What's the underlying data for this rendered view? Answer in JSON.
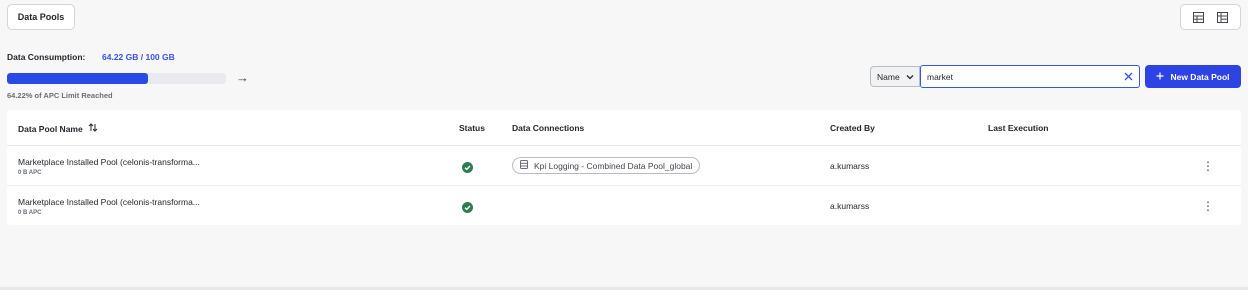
{
  "tabs": {
    "data_pools": "Data Pools"
  },
  "consumption": {
    "label": "Data Consumption:",
    "value": "64.22 GB / 100 GB",
    "percent": 64.22,
    "limit_text": "64.22% of APC Limit Reached"
  },
  "search": {
    "filter_field": "Name",
    "query": "market"
  },
  "toolbar": {
    "new_pool_label": "New Data Pool"
  },
  "table": {
    "headers": {
      "name": "Data Pool Name",
      "status": "Status",
      "connections": "Data Connections",
      "created_by": "Created By",
      "last_execution": "Last Execution"
    },
    "rows": [
      {
        "name": "Marketplace Installed Pool (celonis-transforma...",
        "size": "0 B APC",
        "status": "success",
        "connection": "Kpi Logging - Combined Data Pool_global",
        "created_by": "a.kumarss",
        "last_execution": ""
      },
      {
        "name": "Marketplace Installed Pool (celonis-transforma...",
        "size": "0 B APC",
        "status": "success",
        "connection": "",
        "created_by": "a.kumarss",
        "last_execution": ""
      }
    ]
  },
  "colors": {
    "accent": "#2d43e4",
    "progress": "#2b49e6",
    "success": "#2e7d4f"
  }
}
